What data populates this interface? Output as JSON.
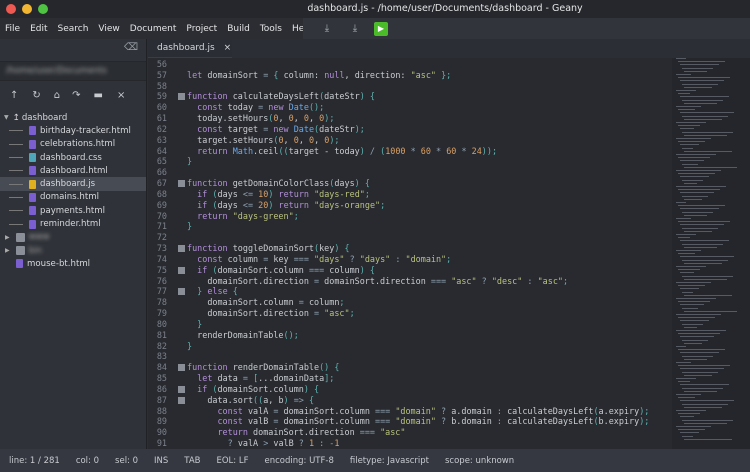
{
  "window": {
    "title": "dashboard.js - /home/user/Documents/dashboard - Geany"
  },
  "menu": [
    "File",
    "Edit",
    "Search",
    "View",
    "Document",
    "Project",
    "Build",
    "Tools",
    "Help"
  ],
  "sidebar": {
    "path": "/home/user/Documents",
    "root": "dashboard",
    "files": [
      {
        "name": "birthday-tracker.html",
        "color": "#7b5fd0"
      },
      {
        "name": "celebrations.html",
        "color": "#7b5fd0"
      },
      {
        "name": "dashboard.css",
        "color": "#4fa6b8"
      },
      {
        "name": "dashboard.html",
        "color": "#7b5fd0"
      },
      {
        "name": "dashboard.js",
        "color": "#e0b020",
        "selected": true
      },
      {
        "name": "domains.html",
        "color": "#7b5fd0"
      },
      {
        "name": "payments.html",
        "color": "#7b5fd0"
      },
      {
        "name": "reminder.html",
        "color": "#7b5fd0"
      }
    ],
    "others": [
      "www",
      "bin",
      "mouse-bt.html"
    ]
  },
  "tab": {
    "label": "dashboard.js",
    "close": "×"
  },
  "editor": {
    "start": 56,
    "folds": [
      59,
      67,
      73,
      75,
      77,
      84,
      86,
      87
    ],
    "lines": [
      [],
      [
        [
          "kw",
          "let"
        ],
        [
          "id",
          " domainSort "
        ],
        [
          "o",
          "= "
        ],
        [
          "p",
          "{ "
        ],
        [
          "id",
          "column: "
        ],
        [
          "kw",
          "null"
        ],
        [
          "id",
          ", direction: "
        ],
        [
          "s",
          "\"asc\""
        ],
        [
          "p",
          " };"
        ]
      ],
      [],
      [
        [
          "kw",
          "function"
        ],
        [
          "id",
          " calculateDaysLeft"
        ],
        [
          "p",
          "("
        ],
        [
          "id",
          "dateStr"
        ],
        [
          "p",
          ") {"
        ]
      ],
      [
        [
          "kw",
          "  const"
        ],
        [
          "id",
          " today "
        ],
        [
          "o",
          "= "
        ],
        [
          "kw",
          "new "
        ],
        [
          "b",
          "Date"
        ],
        [
          "p",
          "();"
        ]
      ],
      [
        [
          "id",
          "  today.setHours"
        ],
        [
          "p",
          "("
        ],
        [
          "n",
          "0"
        ],
        [
          "id",
          ", "
        ],
        [
          "n",
          "0"
        ],
        [
          "id",
          ", "
        ],
        [
          "n",
          "0"
        ],
        [
          "id",
          ", "
        ],
        [
          "n",
          "0"
        ],
        [
          "p",
          ");"
        ]
      ],
      [
        [
          "kw",
          "  const"
        ],
        [
          "id",
          " target "
        ],
        [
          "o",
          "= "
        ],
        [
          "kw",
          "new "
        ],
        [
          "b",
          "Date"
        ],
        [
          "p",
          "("
        ],
        [
          "id",
          "dateStr"
        ],
        [
          "p",
          ");"
        ]
      ],
      [
        [
          "id",
          "  target.setHours"
        ],
        [
          "p",
          "("
        ],
        [
          "n",
          "0"
        ],
        [
          "id",
          ", "
        ],
        [
          "n",
          "0"
        ],
        [
          "id",
          ", "
        ],
        [
          "n",
          "0"
        ],
        [
          "id",
          ", "
        ],
        [
          "n",
          "0"
        ],
        [
          "p",
          ");"
        ]
      ],
      [
        [
          "kw",
          "  return "
        ],
        [
          "b",
          "Math"
        ],
        [
          "id",
          ".ceil"
        ],
        [
          "p",
          "(("
        ],
        [
          "id",
          "target - today"
        ],
        [
          "p",
          ") "
        ],
        [
          "o",
          "/ "
        ],
        [
          "p",
          "("
        ],
        [
          "n",
          "1000"
        ],
        [
          "o",
          " * "
        ],
        [
          "n",
          "60"
        ],
        [
          "o",
          " * "
        ],
        [
          "n",
          "60"
        ],
        [
          "o",
          " * "
        ],
        [
          "n",
          "24"
        ],
        [
          "p",
          "));"
        ]
      ],
      [
        [
          "p",
          "}"
        ]
      ],
      [],
      [
        [
          "kw",
          "function"
        ],
        [
          "id",
          " getDomainColorClass"
        ],
        [
          "p",
          "("
        ],
        [
          "id",
          "days"
        ],
        [
          "p",
          ") {"
        ]
      ],
      [
        [
          "kw",
          "  if "
        ],
        [
          "p",
          "("
        ],
        [
          "id",
          "days "
        ],
        [
          "o",
          "<= "
        ],
        [
          "n",
          "10"
        ],
        [
          "p",
          ") "
        ],
        [
          "kw",
          "return "
        ],
        [
          "s",
          "\"days-red\""
        ],
        [
          "p",
          ";"
        ]
      ],
      [
        [
          "kw",
          "  if "
        ],
        [
          "p",
          "("
        ],
        [
          "id",
          "days "
        ],
        [
          "o",
          "<= "
        ],
        [
          "n",
          "20"
        ],
        [
          "p",
          ") "
        ],
        [
          "kw",
          "return "
        ],
        [
          "s",
          "\"days-orange\""
        ],
        [
          "p",
          ";"
        ]
      ],
      [
        [
          "kw",
          "  return "
        ],
        [
          "s",
          "\"days-green\""
        ],
        [
          "p",
          ";"
        ]
      ],
      [
        [
          "p",
          "}"
        ]
      ],
      [],
      [
        [
          "kw",
          "function"
        ],
        [
          "id",
          " toggleDomainSort"
        ],
        [
          "p",
          "("
        ],
        [
          "id",
          "key"
        ],
        [
          "p",
          ") {"
        ]
      ],
      [
        [
          "kw",
          "  const"
        ],
        [
          "id",
          " column "
        ],
        [
          "o",
          "= "
        ],
        [
          "id",
          "key "
        ],
        [
          "o",
          "=== "
        ],
        [
          "s",
          "\"days\""
        ],
        [
          "o",
          " ? "
        ],
        [
          "s",
          "\"days\""
        ],
        [
          "o",
          " : "
        ],
        [
          "s",
          "\"domain\""
        ],
        [
          "p",
          ";"
        ]
      ],
      [
        [
          "kw",
          "  if "
        ],
        [
          "p",
          "("
        ],
        [
          "id",
          "domainSort.column "
        ],
        [
          "o",
          "=== "
        ],
        [
          "id",
          "column"
        ],
        [
          "p",
          ") {"
        ]
      ],
      [
        [
          "id",
          "    domainSort.direction "
        ],
        [
          "o",
          "= "
        ],
        [
          "id",
          "domainSort.direction "
        ],
        [
          "o",
          "=== "
        ],
        [
          "s",
          "\"asc\""
        ],
        [
          "o",
          " ? "
        ],
        [
          "s",
          "\"desc\""
        ],
        [
          "o",
          " : "
        ],
        [
          "s",
          "\"asc\""
        ],
        [
          "p",
          ";"
        ]
      ],
      [
        [
          "p",
          "  } "
        ],
        [
          "kw",
          "else "
        ],
        [
          "p",
          "{"
        ]
      ],
      [
        [
          "id",
          "    domainSort.column "
        ],
        [
          "o",
          "= "
        ],
        [
          "id",
          "column"
        ],
        [
          "p",
          ";"
        ]
      ],
      [
        [
          "id",
          "    domainSort.direction "
        ],
        [
          "o",
          "= "
        ],
        [
          "s",
          "\"asc\""
        ],
        [
          "p",
          ";"
        ]
      ],
      [
        [
          "p",
          "  }"
        ]
      ],
      [
        [
          "id",
          "  renderDomainTable"
        ],
        [
          "p",
          "();"
        ]
      ],
      [
        [
          "p",
          "}"
        ]
      ],
      [],
      [
        [
          "kw",
          "function"
        ],
        [
          "id",
          " renderDomainTable"
        ],
        [
          "p",
          "() {"
        ]
      ],
      [
        [
          "kw",
          "  let"
        ],
        [
          "id",
          " data "
        ],
        [
          "o",
          "= "
        ],
        [
          "p",
          "["
        ],
        [
          "id",
          "...domainData"
        ],
        [
          "p",
          "];"
        ]
      ],
      [
        [
          "kw",
          "  if "
        ],
        [
          "p",
          "("
        ],
        [
          "id",
          "domainSort.column"
        ],
        [
          "p",
          ") {"
        ]
      ],
      [
        [
          "id",
          "    data.sort"
        ],
        [
          "p",
          "(("
        ],
        [
          "id",
          "a, b"
        ],
        [
          "p",
          ") "
        ],
        [
          "o",
          "=> "
        ],
        [
          "p",
          "{"
        ]
      ],
      [
        [
          "kw",
          "      const"
        ],
        [
          "id",
          " valA "
        ],
        [
          "o",
          "= "
        ],
        [
          "id",
          "domainSort.column "
        ],
        [
          "o",
          "=== "
        ],
        [
          "s",
          "\"domain\""
        ],
        [
          "o",
          " ? "
        ],
        [
          "id",
          "a.domain "
        ],
        [
          "o",
          ": "
        ],
        [
          "id",
          "calculateDaysLeft"
        ],
        [
          "p",
          "("
        ],
        [
          "id",
          "a.expiry"
        ],
        [
          "p",
          ");"
        ]
      ],
      [
        [
          "kw",
          "      const"
        ],
        [
          "id",
          " valB "
        ],
        [
          "o",
          "= "
        ],
        [
          "id",
          "domainSort.column "
        ],
        [
          "o",
          "=== "
        ],
        [
          "s",
          "\"domain\""
        ],
        [
          "o",
          " ? "
        ],
        [
          "id",
          "b.domain "
        ],
        [
          "o",
          ": "
        ],
        [
          "id",
          "calculateDaysLeft"
        ],
        [
          "p",
          "("
        ],
        [
          "id",
          "b.expiry"
        ],
        [
          "p",
          ");"
        ]
      ],
      [
        [
          "kw",
          "      return"
        ],
        [
          "id",
          " domainSort.direction "
        ],
        [
          "o",
          "=== "
        ],
        [
          "s",
          "\"asc\""
        ]
      ],
      [
        [
          "o",
          "        ? "
        ],
        [
          "id",
          "valA "
        ],
        [
          "o",
          "> "
        ],
        [
          "id",
          "valB "
        ],
        [
          "o",
          "? "
        ],
        [
          "n",
          "1"
        ],
        [
          "o",
          " : -"
        ],
        [
          "n",
          "1"
        ]
      ]
    ]
  },
  "status": [
    "line: 1 / 281",
    "col: 0",
    "sel: 0",
    "INS",
    "TAB",
    "EOL: LF",
    "encoding: UTF-8",
    "filetype: Javascript",
    "scope: unknown"
  ]
}
